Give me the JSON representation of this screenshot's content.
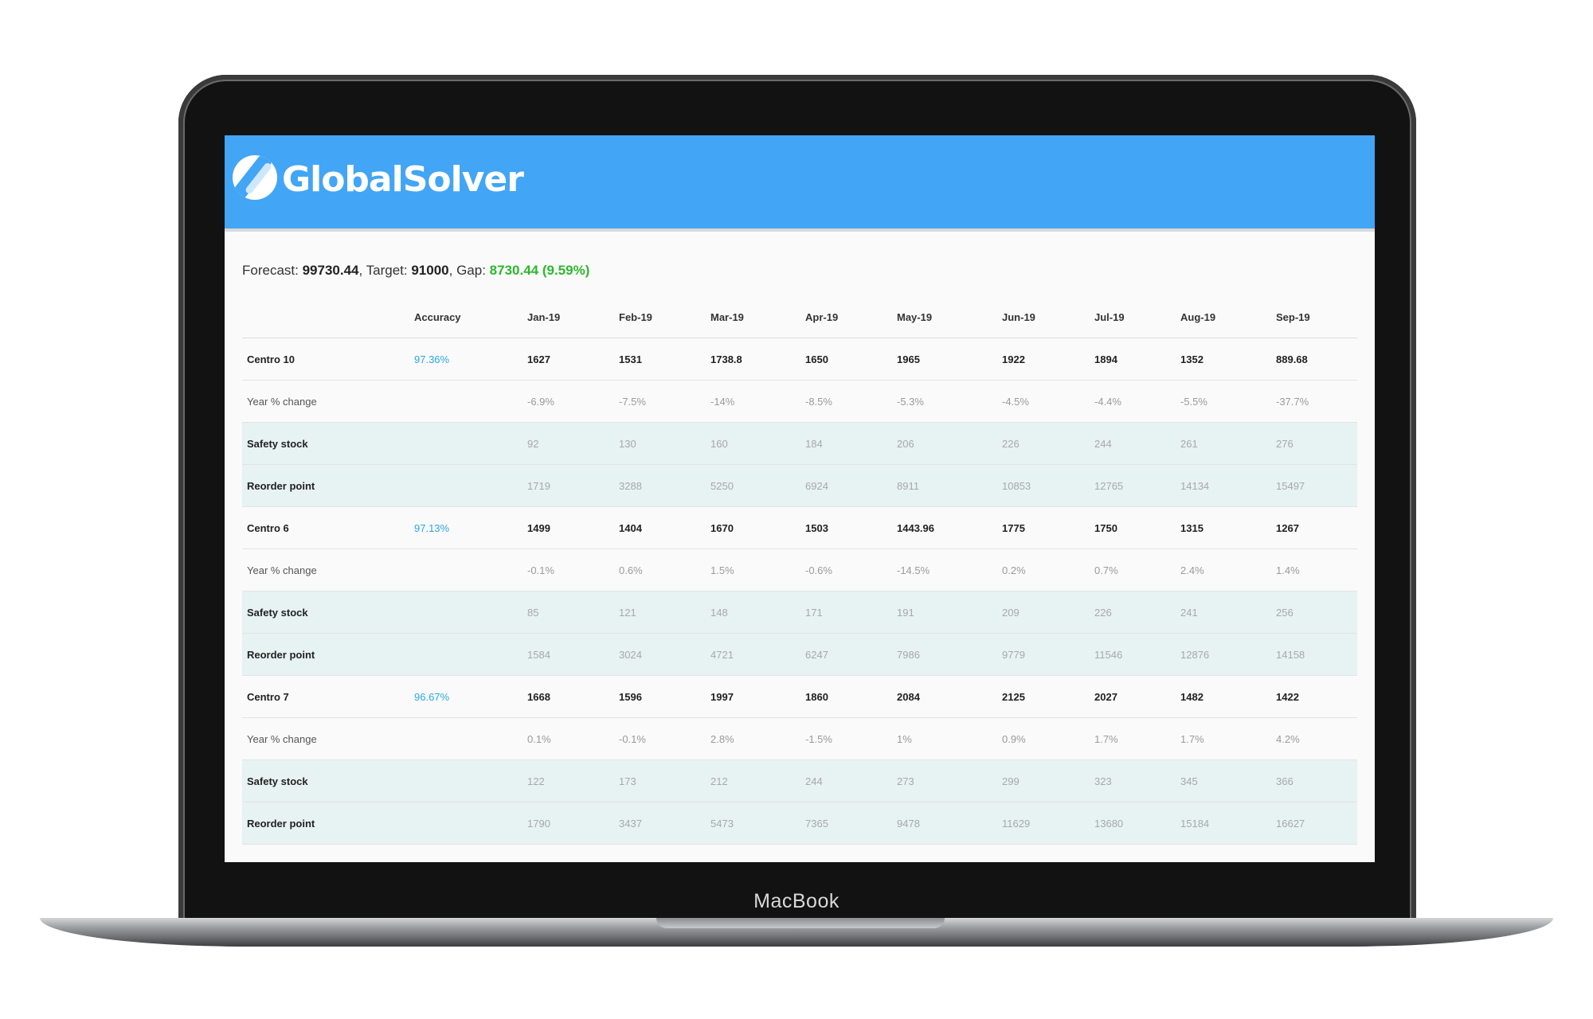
{
  "device": {
    "label": "MacBook"
  },
  "app": {
    "brand": "GlobalSolver",
    "logo_icon": "globalsolver-logo-icon",
    "brand_color": "#42a5f5"
  },
  "summary": {
    "forecast_label": "Forecast: ",
    "forecast_value": "99730.44",
    "target_label": ", Target: ",
    "target_value": "91000",
    "gap_label": ", Gap: ",
    "gap_value": "8730.44",
    "gap_pct_open": " (",
    "gap_pct": "9.59%",
    "gap_pct_close": ")",
    "gap_color": "#2db82d"
  },
  "table": {
    "headers": [
      "",
      "Accuracy",
      "Jan-19",
      "Feb-19",
      "Mar-19",
      "Apr-19",
      "May-19",
      "Jun-19",
      "Jul-19",
      "Aug-19",
      "Sep-19"
    ],
    "groups": [
      {
        "name": "Centro 10",
        "accuracy": "97.36%",
        "values": [
          "1627",
          "1531",
          "1738.8",
          "1650",
          "1965",
          "1922",
          "1894",
          "1352",
          "889.68"
        ],
        "yoy_label": "Year % change",
        "yoy": [
          "-6.9%",
          "-7.5%",
          "-14%",
          "-8.5%",
          "-5.3%",
          "-4.5%",
          "-4.4%",
          "-5.5%",
          "-37.7%"
        ],
        "safety_label": "Safety stock",
        "safety": [
          "92",
          "130",
          "160",
          "184",
          "206",
          "226",
          "244",
          "261",
          "276"
        ],
        "reorder_label": "Reorder point",
        "reorder": [
          "1719",
          "3288",
          "5250",
          "6924",
          "8911",
          "10853",
          "12765",
          "14134",
          "15497"
        ]
      },
      {
        "name": "Centro 6",
        "accuracy": "97.13%",
        "values": [
          "1499",
          "1404",
          "1670",
          "1503",
          "1443.96",
          "1775",
          "1750",
          "1315",
          "1267"
        ],
        "yoy_label": "Year % change",
        "yoy": [
          "-0.1%",
          "0.6%",
          "1.5%",
          "-0.6%",
          "-14.5%",
          "0.2%",
          "0.7%",
          "2.4%",
          "1.4%"
        ],
        "safety_label": "Safety stock",
        "safety": [
          "85",
          "121",
          "148",
          "171",
          "191",
          "209",
          "226",
          "241",
          "256"
        ],
        "reorder_label": "Reorder point",
        "reorder": [
          "1584",
          "3024",
          "4721",
          "6247",
          "7986",
          "9779",
          "11546",
          "12876",
          "14158"
        ]
      },
      {
        "name": "Centro 7",
        "accuracy": "96.67%",
        "values": [
          "1668",
          "1596",
          "1997",
          "1860",
          "2084",
          "2125",
          "2027",
          "1482",
          "1422"
        ],
        "yoy_label": "Year % change",
        "yoy": [
          "0.1%",
          "-0.1%",
          "2.8%",
          "-1.5%",
          "1%",
          "0.9%",
          "1.7%",
          "1.7%",
          "4.2%"
        ],
        "safety_label": "Safety stock",
        "safety": [
          "122",
          "173",
          "212",
          "244",
          "273",
          "299",
          "323",
          "345",
          "366"
        ],
        "reorder_label": "Reorder point",
        "reorder": [
          "1790",
          "3437",
          "5473",
          "7365",
          "9478",
          "11629",
          "13680",
          "15184",
          "16627"
        ]
      }
    ],
    "accuracy_color": "#29a8e6",
    "stock_row_bg": "#e7f2f2"
  }
}
